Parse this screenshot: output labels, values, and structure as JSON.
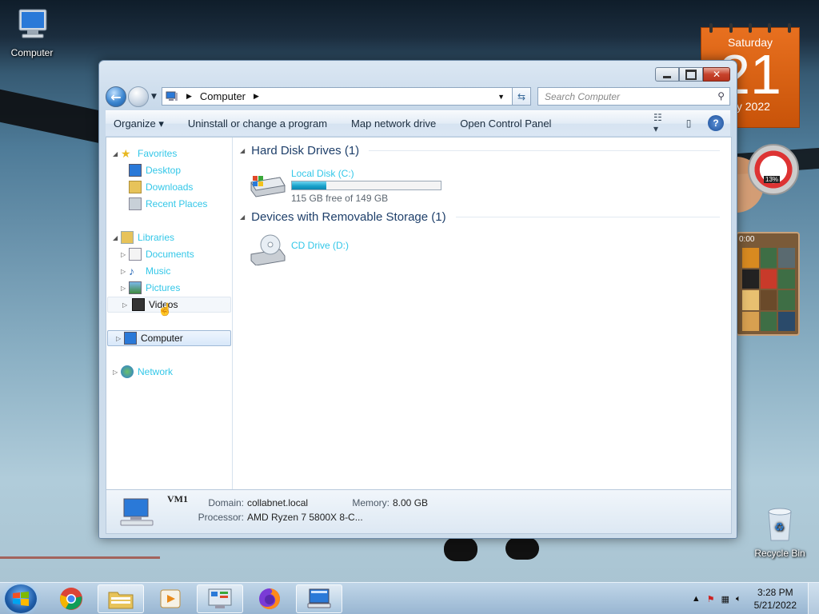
{
  "desktop": {
    "computer_icon_label": "Computer",
    "recycle_bin_label": "Recycle Bin"
  },
  "gadgets": {
    "calendar": {
      "weekday": "Saturday",
      "day": "21",
      "month_year": "ay 2022"
    },
    "cpu_meter": {
      "memory_pct": "13%"
    },
    "puzzle": {
      "time": "0:00"
    }
  },
  "window": {
    "address": {
      "crumb": "Computer"
    },
    "search": {
      "placeholder": "Search Computer"
    },
    "toolbar": {
      "organize": "Organize",
      "uninstall": "Uninstall or change a program",
      "map_drive": "Map network drive",
      "control_panel": "Open Control Panel"
    },
    "nav": {
      "favorites": "Favorites",
      "desktop": "Desktop",
      "downloads": "Downloads",
      "recent": "Recent Places",
      "libraries": "Libraries",
      "documents": "Documents",
      "music": "Music",
      "pictures": "Pictures",
      "videos": "Videos",
      "computer": "Computer",
      "network": "Network"
    },
    "groups": {
      "hdd": "Hard Disk Drives (1)",
      "removable": "Devices with Removable Storage (1)"
    },
    "drives": {
      "c": {
        "label": "Local Disk (C:)",
        "free": "115 GB free of 149 GB",
        "used_fraction": 0.23
      },
      "d": {
        "label": "CD Drive (D:)"
      }
    },
    "details": {
      "name": "VM1",
      "domain_label": "Domain:",
      "domain": "collabnet.local",
      "memory_label": "Memory:",
      "memory": "8.00 GB",
      "processor_label": "Processor:",
      "processor": "AMD Ryzen 7 5800X 8-C..."
    }
  },
  "taskbar": {
    "apps": [
      "start-button",
      "chrome",
      "windows-explorer",
      "media-player",
      "control-panel",
      "firefox",
      "remote-desktop"
    ],
    "clock": {
      "time": "3:28 PM",
      "date": "5/21/2022"
    }
  },
  "colors": {
    "link": "#33c7e8",
    "calendar": "#e8701f",
    "group_head": "#1e3f6a"
  }
}
